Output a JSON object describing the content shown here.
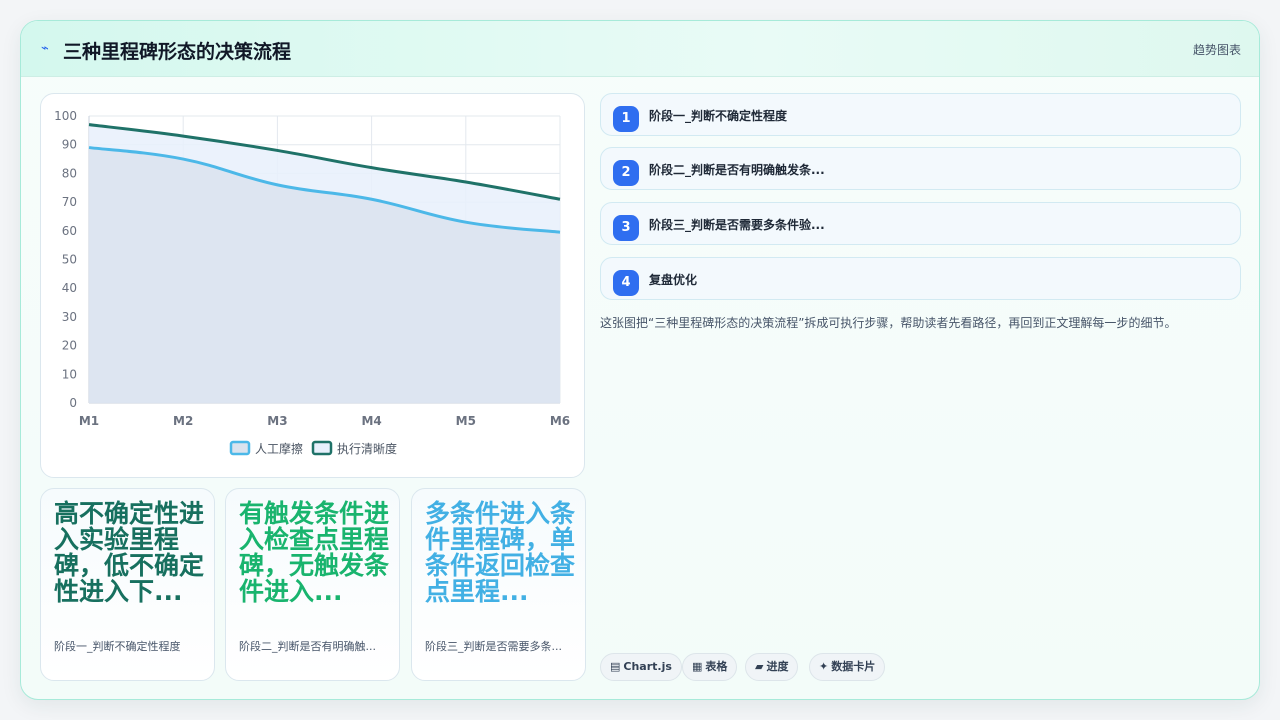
{
  "header": {
    "logo_icon": "trend-icon",
    "logo_glyph": "⌁",
    "title": "三种里程碑形态的决策流程",
    "tag": "趋势图表"
  },
  "chart_data": {
    "type": "area",
    "categories": [
      "M1",
      "M2",
      "M3",
      "M4",
      "M5",
      "M6"
    ],
    "series": [
      {
        "name": "人工摩擦",
        "values": [
          89,
          85,
          76,
          71,
          63,
          59.5
        ],
        "color": "#4cb8e8",
        "fill": "#dbe3ee"
      },
      {
        "name": "执行清晰度",
        "values": [
          97,
          93,
          88,
          82,
          77,
          71
        ],
        "color": "#1f7268",
        "fill": "#e8f0fc"
      }
    ],
    "ylim": [
      0,
      100
    ],
    "yticks": [
      0,
      10,
      20,
      30,
      40,
      50,
      60,
      70,
      80,
      90,
      100
    ],
    "grid": true,
    "legend": "bottom"
  },
  "kpis": [
    {
      "big": "高不确定性进入实验里程碑，低不确定性进入下...",
      "small": "阶段一_判断不确定性程度",
      "color": "#17705f"
    },
    {
      "big": "有触发条件进入检查点里程碑，无触发条件进入...",
      "small": "阶段二_判断是否有明确触...",
      "color": "#19b46e"
    },
    {
      "big": "多条件进入条件里程碑，单条件返回检查点里程...",
      "small": "阶段三_判断是否需要多条...",
      "color": "#42b0e4"
    }
  ],
  "steps": [
    {
      "num": "1",
      "label": "阶段一_判断不确定性程度"
    },
    {
      "num": "2",
      "label": "阶段二_判断是否有明确触发条..."
    },
    {
      "num": "3",
      "label": "阶段三_判断是否需要多条件验..."
    },
    {
      "num": "4",
      "label": "复盘优化"
    }
  ],
  "description": "这张图把“三种里程碑形态的决策流程”拆成可执行步骤，帮助读者先看路径，再回到正文理解每一步的细节。",
  "chips": [
    {
      "icon": "chart-icon",
      "glyph": "▤",
      "label": "Chart.js"
    },
    {
      "icon": "table-icon",
      "glyph": "▦",
      "label": "表格"
    },
    {
      "icon": "progress-icon",
      "glyph": "▰",
      "label": "进度"
    },
    {
      "icon": "card-icon",
      "glyph": "✦",
      "label": "数据卡片"
    }
  ],
  "colors": {
    "accent": "#2f6ef0",
    "border": "#a7ead9"
  }
}
